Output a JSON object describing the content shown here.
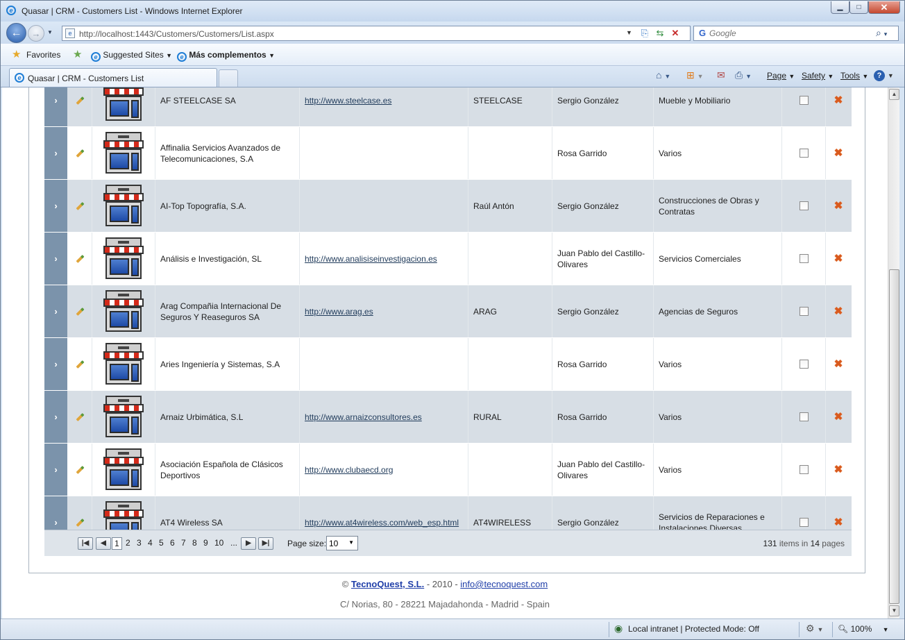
{
  "window": {
    "title": "Quasar | CRM - Customers List - Windows Internet Explorer",
    "url": "http://localhost:1443/Customers/Customers/List.aspx",
    "search_placeholder": "Google"
  },
  "favorites_bar": {
    "favorites": "Favorites",
    "suggested": "Suggested Sites",
    "more": "Más complementos"
  },
  "tab": {
    "label": "Quasar | CRM - Customers List"
  },
  "command_bar": {
    "page": "Page",
    "safety": "Safety",
    "tools": "Tools"
  },
  "customers": [
    {
      "name": "AF STEELCASE SA",
      "web": "http://www.steelcase.es",
      "code": "STEELCASE",
      "owner": "Sergio González",
      "sector": "Mueble y Mobiliario"
    },
    {
      "name": "Affinalia Servicios Avanzados de Telecomunicaciones, S.A",
      "web": "",
      "code": "",
      "owner": "Rosa Garrido",
      "sector": "Varios"
    },
    {
      "name": "AI-Top Topografía, S.A.",
      "web": "",
      "code": "Raúl Antón",
      "owner": "Sergio González",
      "sector": "Construcciones de Obras y Contratas"
    },
    {
      "name": "Análisis e Investigación, SL",
      "web": "http://www.analisiseinvestigacion.es",
      "code": "",
      "owner": "Juan Pablo del Castillo-Olivares",
      "sector": "Servicios Comerciales"
    },
    {
      "name": "Arag Compañia Internacional De Seguros Y Reaseguros SA",
      "web": "http://www.arag.es",
      "code": "ARAG",
      "owner": "Sergio González",
      "sector": "Agencias de Seguros"
    },
    {
      "name": "Aries Ingeniería y Sistemas, S.A",
      "web": "",
      "code": "",
      "owner": "Rosa Garrido",
      "sector": "Varios"
    },
    {
      "name": "Arnaiz Urbimática, S.L",
      "web": "http://www.arnaizconsultores.es",
      "code": "RURAL",
      "owner": "Rosa Garrido",
      "sector": "Varios"
    },
    {
      "name": "Asociación Española de Clásicos Deportivos",
      "web": "http://www.clubaecd.org",
      "code": "",
      "owner": "Juan Pablo del Castillo-Olivares",
      "sector": "Varios"
    },
    {
      "name": "AT4 Wireless SA",
      "web": "http://www.at4wireless.com/web_esp.html",
      "code": "AT4WIRELESS",
      "owner": "Sergio González",
      "sector": "Servicios de Reparaciones e Instalaciones Diversas"
    }
  ],
  "pager": {
    "pages": [
      "1",
      "2",
      "3",
      "4",
      "5",
      "6",
      "7",
      "8",
      "9",
      "10",
      "..."
    ],
    "page_size_label": "Page size:",
    "page_size": "10",
    "items_count": "131",
    "items_label": "items in",
    "pages_count": "14",
    "pages_label": "pages"
  },
  "footer": {
    "copyright": "©",
    "company": "TecnoQuest, S.L.",
    "year": "- 2010 -",
    "email": "info@tecnoquest.com",
    "address": "C/ Norias, 80 - 28221 Majadahonda - Madrid - Spain"
  },
  "status_bar": {
    "zone": "Local intranet | Protected Mode: Off",
    "zoom": "100%"
  },
  "icons": [
    "ie-icon",
    "back-icon",
    "forward-icon",
    "refresh-icon",
    "stop-icon",
    "compat-icon",
    "search-icon",
    "favorites-star-icon",
    "home-icon",
    "feeds-icon",
    "mail-icon",
    "print-icon",
    "help-icon",
    "expand-icon",
    "edit-pencil-icon",
    "customer-shop-icon",
    "delete-icon"
  ],
  "colors": {
    "row_alt": "#d7dee5",
    "expand_col": "#7b93ab",
    "link": "#1f3a5a",
    "delete": "#d95a1e"
  }
}
